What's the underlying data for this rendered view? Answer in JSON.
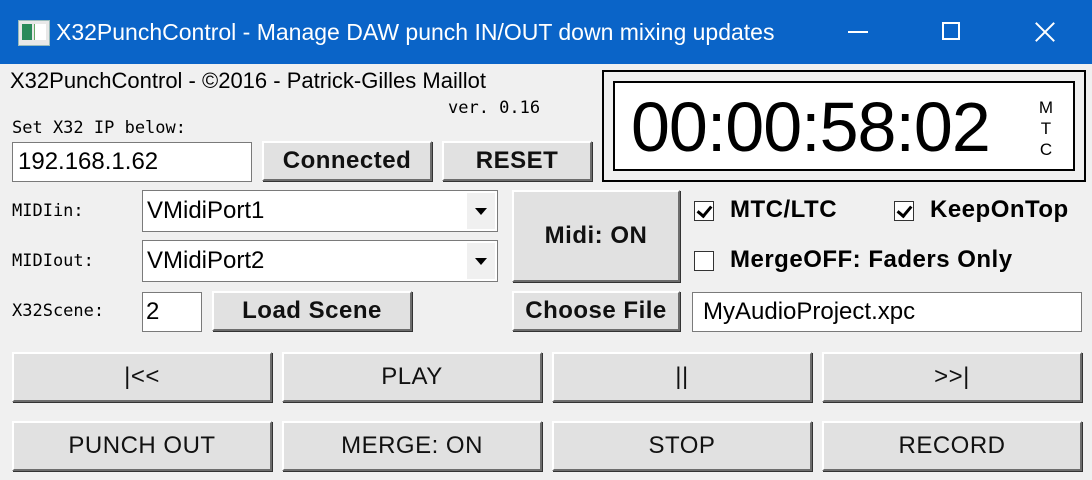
{
  "window": {
    "title": "X32PunchControl - Manage DAW punch IN/OUT down mixing updates"
  },
  "header": {
    "copyright": "X32PunchControl - ©2016 - Patrick-Gilles Maillot",
    "version": "ver. 0.16",
    "ip_label": "Set X32 IP below:"
  },
  "connection": {
    "ip_value": "192.168.1.62",
    "connect_button": "Connected",
    "reset_button": "RESET"
  },
  "clock": {
    "time": "00:00:58:02",
    "mode_letters": [
      "M",
      "T",
      "C"
    ]
  },
  "midi": {
    "in_label": "MIDIin:",
    "in_value": "VMidiPort1",
    "out_label": "MIDIout:",
    "out_value": "VMidiPort2",
    "toggle_button": "Midi: ON"
  },
  "options": {
    "mtc_ltc": {
      "label": "MTC/LTC",
      "checked": true
    },
    "keep_on_top": {
      "label": "KeepOnTop",
      "checked": true
    },
    "merge_off": {
      "label": "MergeOFF: Faders Only",
      "checked": false
    }
  },
  "scene": {
    "label": "X32Scene:",
    "value": "2",
    "load_button": "Load Scene"
  },
  "file": {
    "choose_button": "Choose File",
    "filename": "MyAudioProject.xpc"
  },
  "transport": {
    "rewind": "|<<",
    "play": "PLAY",
    "pause": "||",
    "forward": ">>|",
    "punch_out": "PUNCH OUT",
    "merge": "MERGE: ON",
    "stop": "STOP",
    "record": "RECORD"
  }
}
